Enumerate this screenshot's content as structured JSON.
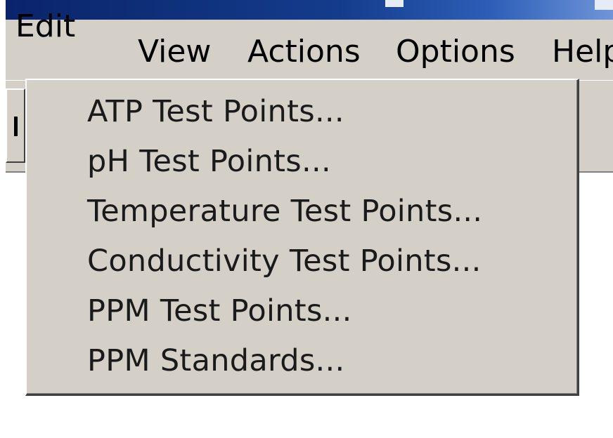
{
  "menu_bar": {
    "items": [
      {
        "label": "Edit",
        "active": true
      },
      {
        "label": "View"
      },
      {
        "label": "Actions"
      },
      {
        "label": "Options"
      },
      {
        "label": "Help"
      }
    ]
  },
  "edit_menu": {
    "items": [
      {
        "label": "ATP Test Points..."
      },
      {
        "label": "pH Test Points..."
      },
      {
        "label": "Temperature Test Points..."
      },
      {
        "label": "Conductivity Test Points..."
      },
      {
        "label": "PPM Test Points..."
      },
      {
        "label": "PPM Standards..."
      }
    ]
  },
  "colors": {
    "title_bar": "#0a246a",
    "menu_face": "#d4d0c8",
    "content_background": "#ffffff"
  }
}
